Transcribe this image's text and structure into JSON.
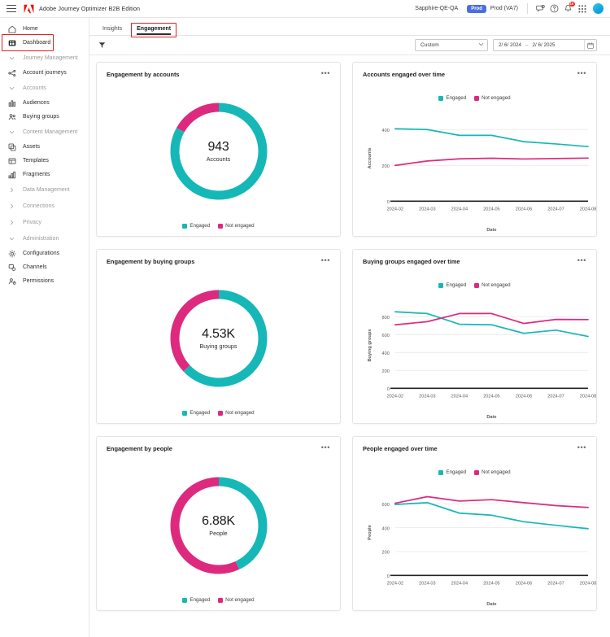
{
  "topbar": {
    "menu_icon": "hamburger-icon",
    "brand_icon": "adobe-logo-icon",
    "app_title": "Adobe Journey Optimizer B2B Edition",
    "org_name": "Sapphire-QE-QA",
    "env_badge": "Prod",
    "env_label": "Prod (VA7)",
    "feedback_icon": "feedback-icon",
    "help_icon": "help-icon",
    "notifications_icon": "bell-icon",
    "notifications_count": "10",
    "apps_icon": "app-grid-icon",
    "avatar": "user-avatar",
    "badge_color": "#4a6ee0",
    "badge_red": "#e8271d"
  },
  "sidebar": {
    "items": [
      {
        "label": "Home",
        "icon": "home-icon",
        "type": "item",
        "active": false
      },
      {
        "label": "Dashboard",
        "icon": "dashboard-icon",
        "type": "item",
        "active": true
      },
      {
        "label": "Journey Management",
        "icon": "chevron-down-icon",
        "type": "group"
      },
      {
        "label": "Account journeys",
        "icon": "journey-icon",
        "type": "item",
        "active": false
      },
      {
        "label": "Accounts",
        "icon": "chevron-down-icon",
        "type": "group"
      },
      {
        "label": "Audiences",
        "icon": "audiences-icon",
        "type": "item",
        "active": false
      },
      {
        "label": "Buying groups",
        "icon": "buying-groups-icon",
        "type": "item",
        "active": false
      },
      {
        "label": "Content Management",
        "icon": "chevron-down-icon",
        "type": "group"
      },
      {
        "label": "Assets",
        "icon": "assets-icon",
        "type": "item",
        "active": false
      },
      {
        "label": "Templates",
        "icon": "templates-icon",
        "type": "item",
        "active": false
      },
      {
        "label": "Fragments",
        "icon": "fragments-icon",
        "type": "item",
        "active": false
      },
      {
        "label": "Data Management",
        "icon": "chevron-right-icon",
        "type": "group"
      },
      {
        "label": "Connections",
        "icon": "chevron-right-icon",
        "type": "group"
      },
      {
        "label": "Privacy",
        "icon": "chevron-right-icon",
        "type": "group"
      },
      {
        "label": "Administration",
        "icon": "chevron-down-icon",
        "type": "group"
      },
      {
        "label": "Configurations",
        "icon": "gear-icon",
        "type": "item",
        "active": false
      },
      {
        "label": "Channels",
        "icon": "channels-icon",
        "type": "item",
        "active": false
      },
      {
        "label": "Permissions",
        "icon": "permissions-icon",
        "type": "item",
        "active": false
      }
    ]
  },
  "tabs": [
    {
      "label": "Insights",
      "active": false
    },
    {
      "label": "Engagement",
      "active": true
    }
  ],
  "filterbar": {
    "filter_icon": "funnel-icon",
    "preset_value": "Custom",
    "chevron_icon": "chevron-down-icon",
    "date_start": "2/ 6/ 2024",
    "date_dash": "–",
    "date_end": "2/ 6/ 2025",
    "calendar_icon": "calendar-icon"
  },
  "colors": {
    "engaged": "#16b7b7",
    "not_engaged": "#dd2a7e"
  },
  "legend": {
    "engaged": "Engaged",
    "not_engaged": "Not engaged"
  },
  "cards": {
    "engagement_accounts": {
      "title": "Engagement by accounts",
      "menu": "•••"
    },
    "accounts_over_time": {
      "title": "Accounts engaged over time",
      "menu": "•••"
    },
    "engagement_buying_groups": {
      "title": "Engagement by buying groups",
      "menu": "•••"
    },
    "buying_groups_over_time": {
      "title": "Buying groups engaged over time",
      "menu": "•••"
    },
    "engagement_people": {
      "title": "Engagement by people",
      "menu": "•••"
    },
    "people_over_time": {
      "title": "People engaged over time",
      "menu": "•••"
    }
  },
  "chart_data": [
    {
      "id": "engagement-by-accounts",
      "type": "pie",
      "title": "Engagement by accounts",
      "center_value": "943",
      "center_label": "Accounts",
      "labels": [
        "Engaged",
        "Not engaged"
      ],
      "values": [
        83,
        17
      ],
      "colors": [
        "#16b7b7",
        "#dd2a7e"
      ],
      "legend_position": "bottom"
    },
    {
      "id": "accounts-engaged-over-time",
      "type": "line",
      "title": "Accounts engaged over time",
      "xlabel": "Date",
      "ylabel": "Accounts",
      "categories": [
        "2024-02",
        "2024-03",
        "2024-04",
        "2024-05",
        "2024-06",
        "2024-07",
        "2024-08"
      ],
      "ylim": [
        0,
        480
      ],
      "yticks": [
        0,
        200,
        400
      ],
      "grid": true,
      "legend_position": "top",
      "series": [
        {
          "name": "Engaged",
          "color": "#16b7b7",
          "values": [
            405,
            400,
            368,
            368,
            333,
            320,
            305
          ]
        },
        {
          "name": "Not engaged",
          "color": "#dd2a7e",
          "values": [
            200,
            225,
            237,
            240,
            236,
            238,
            241
          ]
        }
      ]
    },
    {
      "id": "engagement-by-buying-groups",
      "type": "pie",
      "title": "Engagement by buying groups",
      "center_value": "4.53K",
      "center_label": "Buying groups",
      "labels": [
        "Engaged",
        "Not engaged"
      ],
      "values": [
        63,
        37
      ],
      "colors": [
        "#16b7b7",
        "#dd2a7e"
      ],
      "legend_position": "bottom"
    },
    {
      "id": "buying-groups-engaged-over-time",
      "type": "line",
      "title": "Buying groups engaged over time",
      "xlabel": "Date",
      "ylabel": "Buying groups",
      "categories": [
        "2024-02",
        "2024-03",
        "2024-04",
        "2024-05",
        "2024-06",
        "2024-07",
        "2024-08"
      ],
      "ylim": [
        0,
        960
      ],
      "yticks": [
        0,
        200,
        400,
        600,
        800
      ],
      "grid": true,
      "legend_position": "top",
      "series": [
        {
          "name": "Engaged",
          "color": "#16b7b7",
          "values": [
            855,
            835,
            715,
            710,
            615,
            650,
            580
          ]
        },
        {
          "name": "Not engaged",
          "color": "#dd2a7e",
          "values": [
            710,
            745,
            835,
            835,
            725,
            770,
            768
          ]
        }
      ]
    },
    {
      "id": "engagement-by-people",
      "type": "pie",
      "title": "Engagement by people",
      "center_value": "6.88K",
      "center_label": "People",
      "labels": [
        "Engaged",
        "Not engaged"
      ],
      "values": [
        43,
        57
      ],
      "colors": [
        "#16b7b7",
        "#dd2a7e"
      ],
      "legend_position": "bottom"
    },
    {
      "id": "people-engaged-over-time",
      "type": "line",
      "title": "People engaged over time",
      "xlabel": "Date",
      "ylabel": "People",
      "categories": [
        "2024-02",
        "2024-03",
        "2024-04",
        "2024-05",
        "2024-06",
        "2024-07",
        "2024-08"
      ],
      "ylim": [
        0,
        720
      ],
      "yticks": [
        0,
        200,
        400,
        600
      ],
      "grid": true,
      "legend_position": "top",
      "series": [
        {
          "name": "Engaged",
          "color": "#16b7b7",
          "values": [
            595,
            610,
            522,
            505,
            450,
            420,
            392
          ]
        },
        {
          "name": "Not engaged",
          "color": "#dd2a7e",
          "values": [
            605,
            660,
            623,
            635,
            610,
            585,
            570
          ]
        }
      ]
    }
  ]
}
